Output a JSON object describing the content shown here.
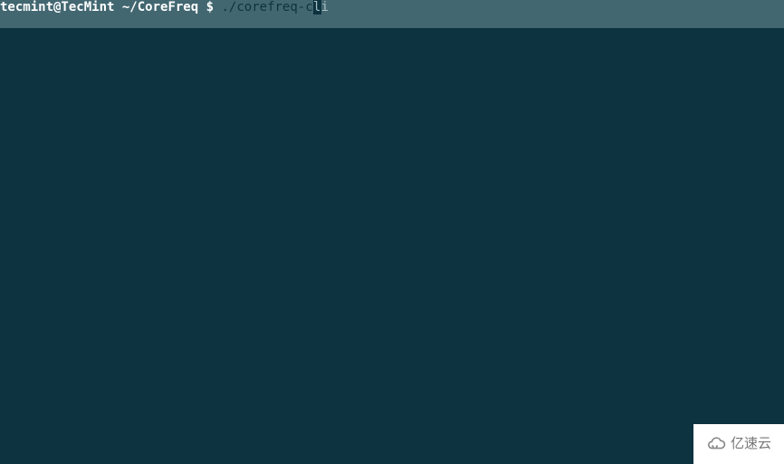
{
  "prompt": {
    "user_host": "tecmint@TecMint",
    "path": "~/CoreFreq",
    "symbol": "$",
    "typed_prefix": ".",
    "typed_slash_cmd": "/corefreq-c",
    "cursor_char": "l",
    "suggestion_tail": "i"
  },
  "watermark": {
    "text": "亿速云"
  }
}
